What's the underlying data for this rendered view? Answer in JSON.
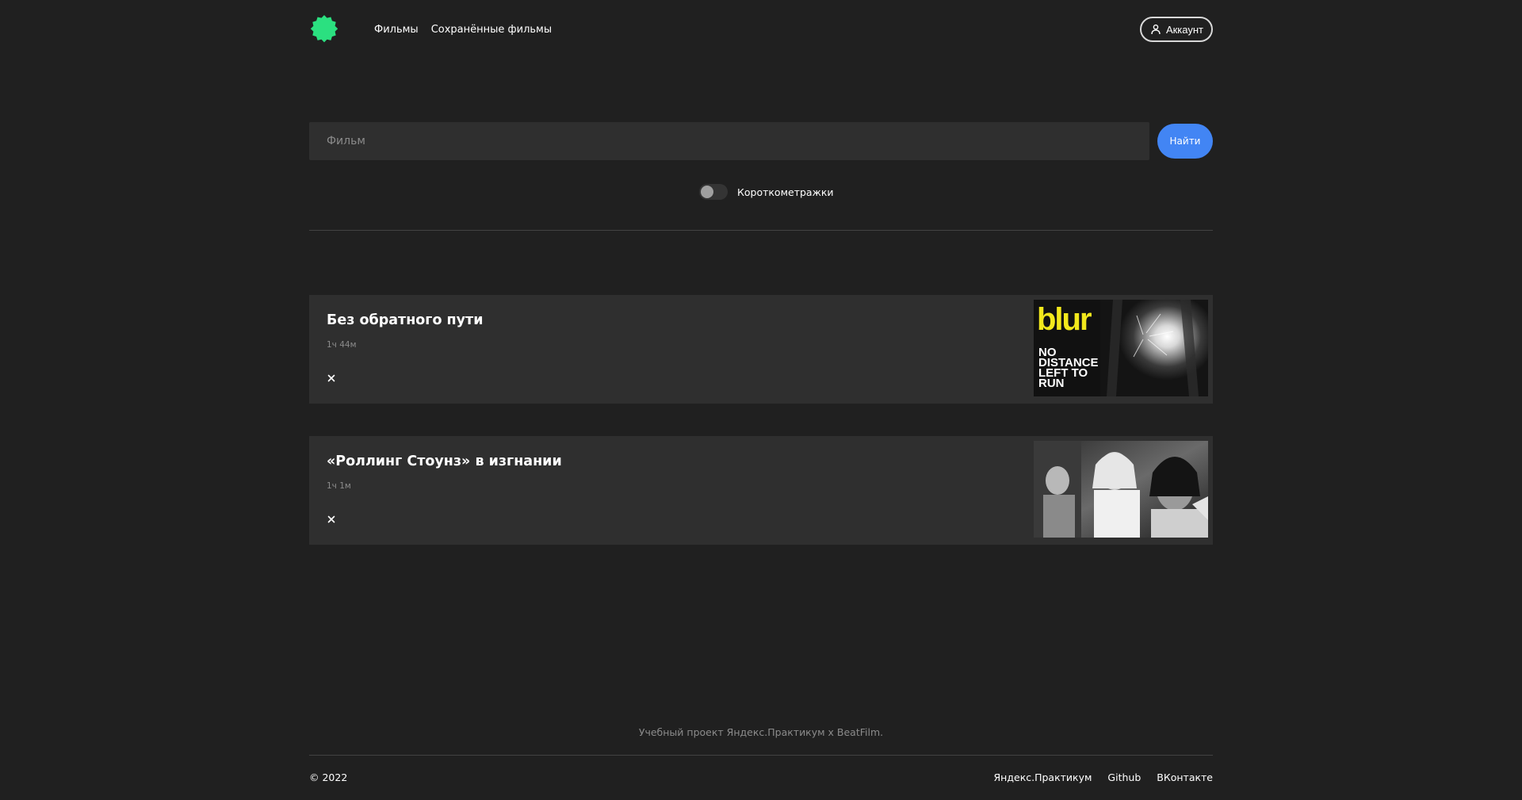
{
  "header": {
    "logo": "green-flower-logo",
    "nav": {
      "movies": "Фильмы",
      "saved_movies": "Сохранённые фильмы"
    },
    "account_label": "Аккаунт",
    "account_icon": "user-icon"
  },
  "search": {
    "placeholder": "Фильм",
    "value": "",
    "button_label": "Найти"
  },
  "filter": {
    "label": "Короткометражки",
    "enabled": false
  },
  "movies": [
    {
      "title": "Без обратного пути",
      "duration": "1ч 44м",
      "remove_icon": "close-icon",
      "poster_text": {
        "brand": "blur",
        "line1": "NO",
        "line2": "DISTANCE",
        "line3": "LEFT TO",
        "line4": "RUN"
      }
    },
    {
      "title": "«Роллинг Стоунз» в изгнании",
      "duration": "1ч 1м",
      "remove_icon": "close-icon"
    }
  ],
  "footer": {
    "note": "Учебный проект Яндекс.Практикум х BeatFilm.",
    "copyright": "© 2022",
    "links": {
      "yandex": "Яндекс.Практикум",
      "github": "Github",
      "vk": "ВКонтакте"
    }
  },
  "colors": {
    "background": "#202020",
    "card": "#2f2f2f",
    "accent_button": "#4285f4",
    "logo": "#2be080",
    "muted_text": "#8b8b8b"
  }
}
